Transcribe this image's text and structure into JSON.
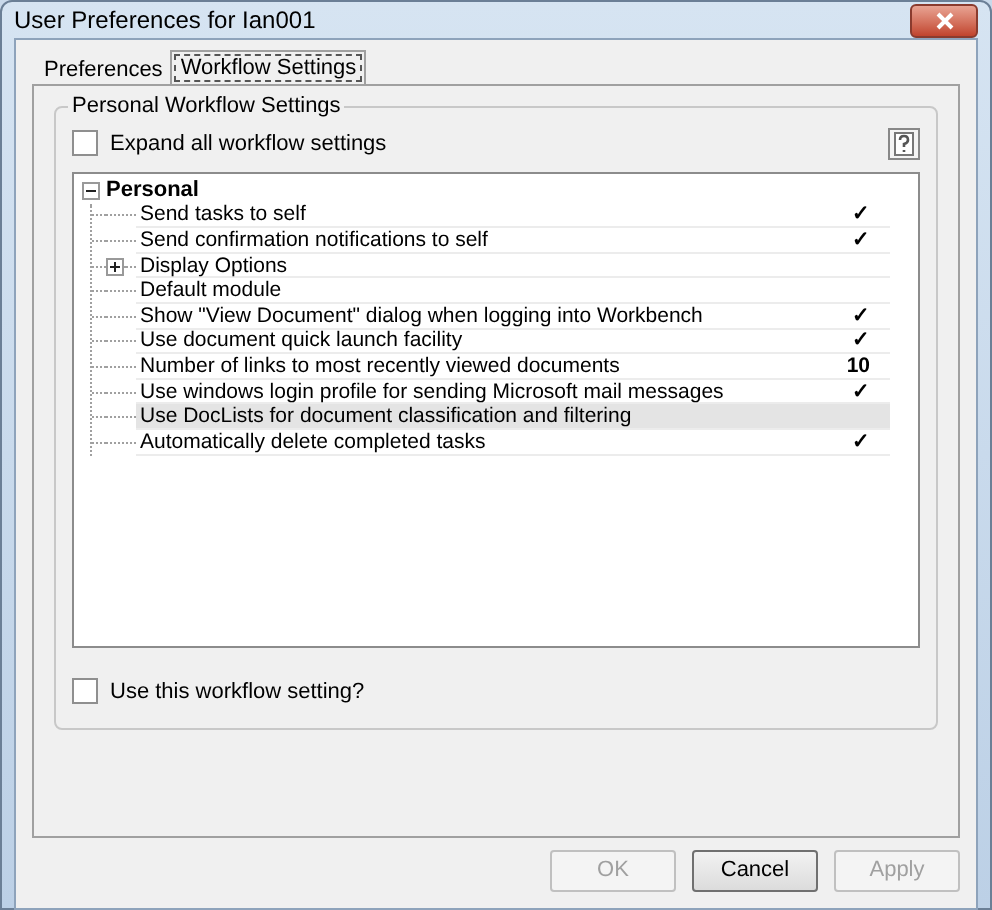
{
  "window": {
    "title": "User Preferences for Ian001"
  },
  "tabs": [
    {
      "label": "Preferences",
      "selected": false
    },
    {
      "label": "Workflow Settings",
      "selected": true
    }
  ],
  "group": {
    "title": "Personal Workflow Settings",
    "expand_all": {
      "label": "Expand all workflow settings",
      "checked": false
    },
    "tree": [
      {
        "label": "Personal",
        "expanded": true,
        "children": [
          {
            "label": "Send tasks to self",
            "value": "✓",
            "selected": false
          },
          {
            "label": "Send confirmation notifications to self",
            "value": "✓",
            "selected": false
          },
          {
            "label": "Display Options",
            "expanded": false,
            "selected": false
          },
          {
            "label": "Default module",
            "selected": false
          },
          {
            "label": "Show \"View Document\" dialog when logging into Workbench",
            "value": "✓",
            "selected": false
          },
          {
            "label": "Use document quick launch facility",
            "value": "✓",
            "selected": false
          },
          {
            "label": "Number of links to most recently viewed documents",
            "value": "10",
            "selected": false
          },
          {
            "label": "Use windows login profile for sending Microsoft mail messages",
            "value": "✓",
            "selected": false
          },
          {
            "label": "Use DocLists for document classification and filtering",
            "selected": true
          },
          {
            "label": "Automatically delete completed tasks",
            "value": "✓",
            "selected": false
          }
        ]
      }
    ],
    "use_setting": {
      "label": "Use this workflow setting?",
      "checked": false
    }
  },
  "buttons": [
    {
      "label": "OK",
      "disabled": true
    },
    {
      "label": "Cancel",
      "disabled": false
    },
    {
      "label": "Apply",
      "disabled": true
    }
  ]
}
